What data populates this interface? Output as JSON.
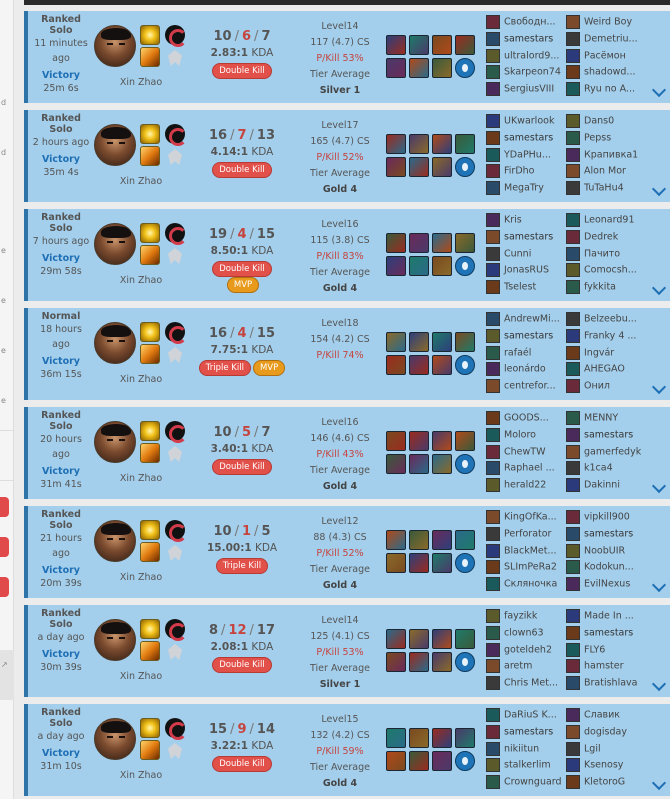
{
  "champion": {
    "name": "Xin Zhao"
  },
  "labels": {
    "kda_suffix": "KDA",
    "tier_average": "Tier Average",
    "kill_pct_prefix": "P/Kill"
  },
  "matches": [
    {
      "type": "Ranked Solo",
      "time_ago": "11 minutes ago",
      "result": "Victory",
      "length": "25m 6s",
      "k": "10",
      "d": "6",
      "a": "7",
      "ratio": "2.83",
      "badges": [
        "Double Kill"
      ],
      "level": "Level14",
      "cs": "117 (4.7) CS",
      "pkill": "P/Kill 53%",
      "tier": "Silver 1",
      "show_tier": true,
      "team1": [
        "Свободн...",
        "samestars",
        "ultralord9...",
        "Skarpeon74",
        "SergiusVIII"
      ],
      "team2": [
        "Weird Boy",
        "Demetriu...",
        "Расёмон",
        "shadowd...",
        "Ryu no A..."
      ]
    },
    {
      "type": "Ranked Solo",
      "time_ago": "2 hours ago",
      "result": "Victory",
      "length": "35m 4s",
      "k": "16",
      "d": "7",
      "a": "13",
      "ratio": "4.14",
      "badges": [
        "Double Kill"
      ],
      "level": "Level17",
      "cs": "165 (4.7) CS",
      "pkill": "P/Kill 52%",
      "tier": "Gold 4",
      "show_tier": true,
      "team1": [
        "UKwarlook",
        "samestars",
        "YDaPHu...",
        "FirDho",
        "MegaTry"
      ],
      "team2": [
        "Dans0",
        "Pepss",
        "Крапивка1",
        "Alon Mor",
        "TuTaHu4"
      ]
    },
    {
      "type": "Ranked Solo",
      "time_ago": "7 hours ago",
      "result": "Victory",
      "length": "29m 58s",
      "k": "19",
      "d": "4",
      "a": "15",
      "ratio": "8.50",
      "badges": [
        "Double Kill",
        "MVP"
      ],
      "level": "Level16",
      "cs": "115 (3.8) CS",
      "pkill": "P/Kill 83%",
      "tier": "Gold 4",
      "show_tier": true,
      "team1": [
        "Kris",
        "samestars",
        "Cunni",
        "JonasRUS",
        "Tselest"
      ],
      "team2": [
        "Leonard91",
        "Dedrek",
        "Пачито",
        "Comocsh...",
        "fykkita"
      ]
    },
    {
      "type": "Normal",
      "time_ago": "18 hours ago",
      "result": "Victory",
      "length": "36m 15s",
      "k": "16",
      "d": "4",
      "a": "15",
      "ratio": "7.75",
      "badges": [
        "Triple Kill",
        "MVP"
      ],
      "level": "Level18",
      "cs": "154 (4.2) CS",
      "pkill": "P/Kill 74%",
      "tier": "",
      "show_tier": false,
      "team1": [
        "AndrewMi...",
        "samestars",
        "rafaél",
        "leonárdo",
        "centrefor..."
      ],
      "team2": [
        "Belzeebu...",
        "Franky 4 ...",
        "Ingvár",
        "AHEGAO",
        "Онил"
      ]
    },
    {
      "type": "Ranked Solo",
      "time_ago": "20 hours ago",
      "result": "Victory",
      "length": "31m 41s",
      "k": "10",
      "d": "5",
      "a": "7",
      "ratio": "3.40",
      "badges": [
        "Double Kill"
      ],
      "level": "Level16",
      "cs": "146 (4.6) CS",
      "pkill": "P/Kill 43%",
      "tier": "Gold 4",
      "show_tier": true,
      "team1": [
        "GOODS...",
        "Moloro",
        "ChewTW",
        "Raphael ...",
        "herald22"
      ],
      "team2": [
        "MENNY",
        "samestars",
        "gamerfedyk",
        "k1ca4",
        "Dakinni"
      ]
    },
    {
      "type": "Ranked Solo",
      "time_ago": "21 hours ago",
      "result": "Victory",
      "length": "20m 39s",
      "k": "10",
      "d": "1",
      "a": "5",
      "ratio": "15.00",
      "badges": [
        "Triple Kill"
      ],
      "level": "Level12",
      "cs": "88 (4.3) CS",
      "pkill": "P/Kill 52%",
      "tier": "Gold 4",
      "show_tier": true,
      "team1": [
        "KingOfKa...",
        "Perforator",
        "BlackMet...",
        "SLImPeRa2",
        "Скляночка"
      ],
      "team2": [
        "vipkill900",
        "samestars",
        "NoobUIR",
        "Kodokun...",
        "EvilNexus"
      ]
    },
    {
      "type": "Ranked Solo",
      "time_ago": "a day ago",
      "result": "Victory",
      "length": "30m 39s",
      "k": "8",
      "d": "12",
      "a": "17",
      "ratio": "2.08",
      "badges": [
        "Double Kill"
      ],
      "level": "Level14",
      "cs": "125 (4.1) CS",
      "pkill": "P/Kill 53%",
      "tier": "Silver 1",
      "show_tier": true,
      "team1": [
        "fayzikk",
        "clown63",
        "goteldeh2",
        "aretm",
        "Chris Met..."
      ],
      "team2": [
        "Made In ...",
        "samestars",
        "FLY6",
        "hamster",
        "Bratishlava"
      ]
    },
    {
      "type": "Ranked Solo",
      "time_ago": "a day ago",
      "result": "Victory",
      "length": "31m 10s",
      "k": "15",
      "d": "9",
      "a": "14",
      "ratio": "3.22",
      "badges": [
        "Double Kill"
      ],
      "level": "Level15",
      "cs": "132 (4.2) CS",
      "pkill": "P/Kill 59%",
      "tier": "Gold 4",
      "show_tier": true,
      "team1": [
        "DaRiuS K...",
        "samestars",
        "nikiitun",
        "stalkerlim",
        "Crownguard"
      ],
      "team2": [
        "Славик",
        "dogisday",
        "Lgil",
        "Ksenosy",
        "KletoroG"
      ]
    }
  ]
}
